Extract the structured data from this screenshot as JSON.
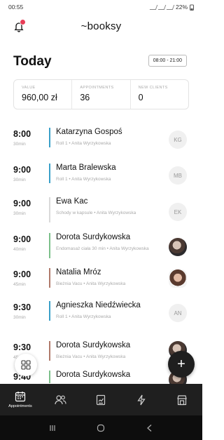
{
  "status_bar": {
    "time": "00:55",
    "battery": "22%"
  },
  "header": {
    "logo": "~booksy"
  },
  "title": "Today",
  "hours": "08:00 - 21:00",
  "stats": [
    {
      "label": "VALUE",
      "value": "960,00 zł"
    },
    {
      "label": "APPOINTMENTS",
      "value": "36"
    },
    {
      "label": "NEW CLIENTS",
      "value": "0"
    }
  ],
  "appointments": [
    {
      "time": "8:00",
      "duration": "30min",
      "name": "Katarzyna Gospoś",
      "service": "Roll 1 • Anita Wyrzykowska",
      "avatar_initials": "KG",
      "bar_color": "#3aa0c8"
    },
    {
      "time": "9:00",
      "duration": "30min",
      "name": "Marta Bralewska",
      "service": "Roll 1 • Anita Wyrzykowska",
      "avatar_initials": "MB",
      "bar_color": "#3aa0c8"
    },
    {
      "time": "9:00",
      "duration": "30min",
      "name": "Ewa Kac",
      "service": "Schody w kapsule • Anita Wyrzykowska",
      "avatar_initials": "EK",
      "bar_color": "#d9d9d9"
    },
    {
      "time": "9:00",
      "duration": "40min",
      "name": "Dorota Surdykowska",
      "service": "Endomasaż ciała 30 min • Anita Wyrzykowska",
      "avatar_initials": "",
      "bar_color": "#7bc08a"
    },
    {
      "time": "9:00",
      "duration": "45min",
      "name": "Natalia Mróz",
      "service": "Bieżnia Vacu • Anita Wyrzykowska",
      "avatar_initials": "",
      "bar_color": "#b07a6a"
    },
    {
      "time": "9:30",
      "duration": "30min",
      "name": "Agnieszka Niedźwiecka",
      "service": "Roll 1 • Anita Wyrzykowska",
      "avatar_initials": "AN",
      "bar_color": "#3aa0c8"
    },
    {
      "time": "9:30",
      "duration": "45min",
      "name": "Dorota Surdykowska",
      "service": "Bieżnia Vacu • Anita Wyrzykowska",
      "avatar_initials": "",
      "bar_color": "#b07a6a"
    },
    {
      "time": "9:40",
      "duration": "",
      "name": "Dorota Surdykowska",
      "service": "",
      "avatar_initials": "",
      "bar_color": "#7bc08a"
    }
  ],
  "tabbar": {
    "active_label": "Appointments"
  }
}
